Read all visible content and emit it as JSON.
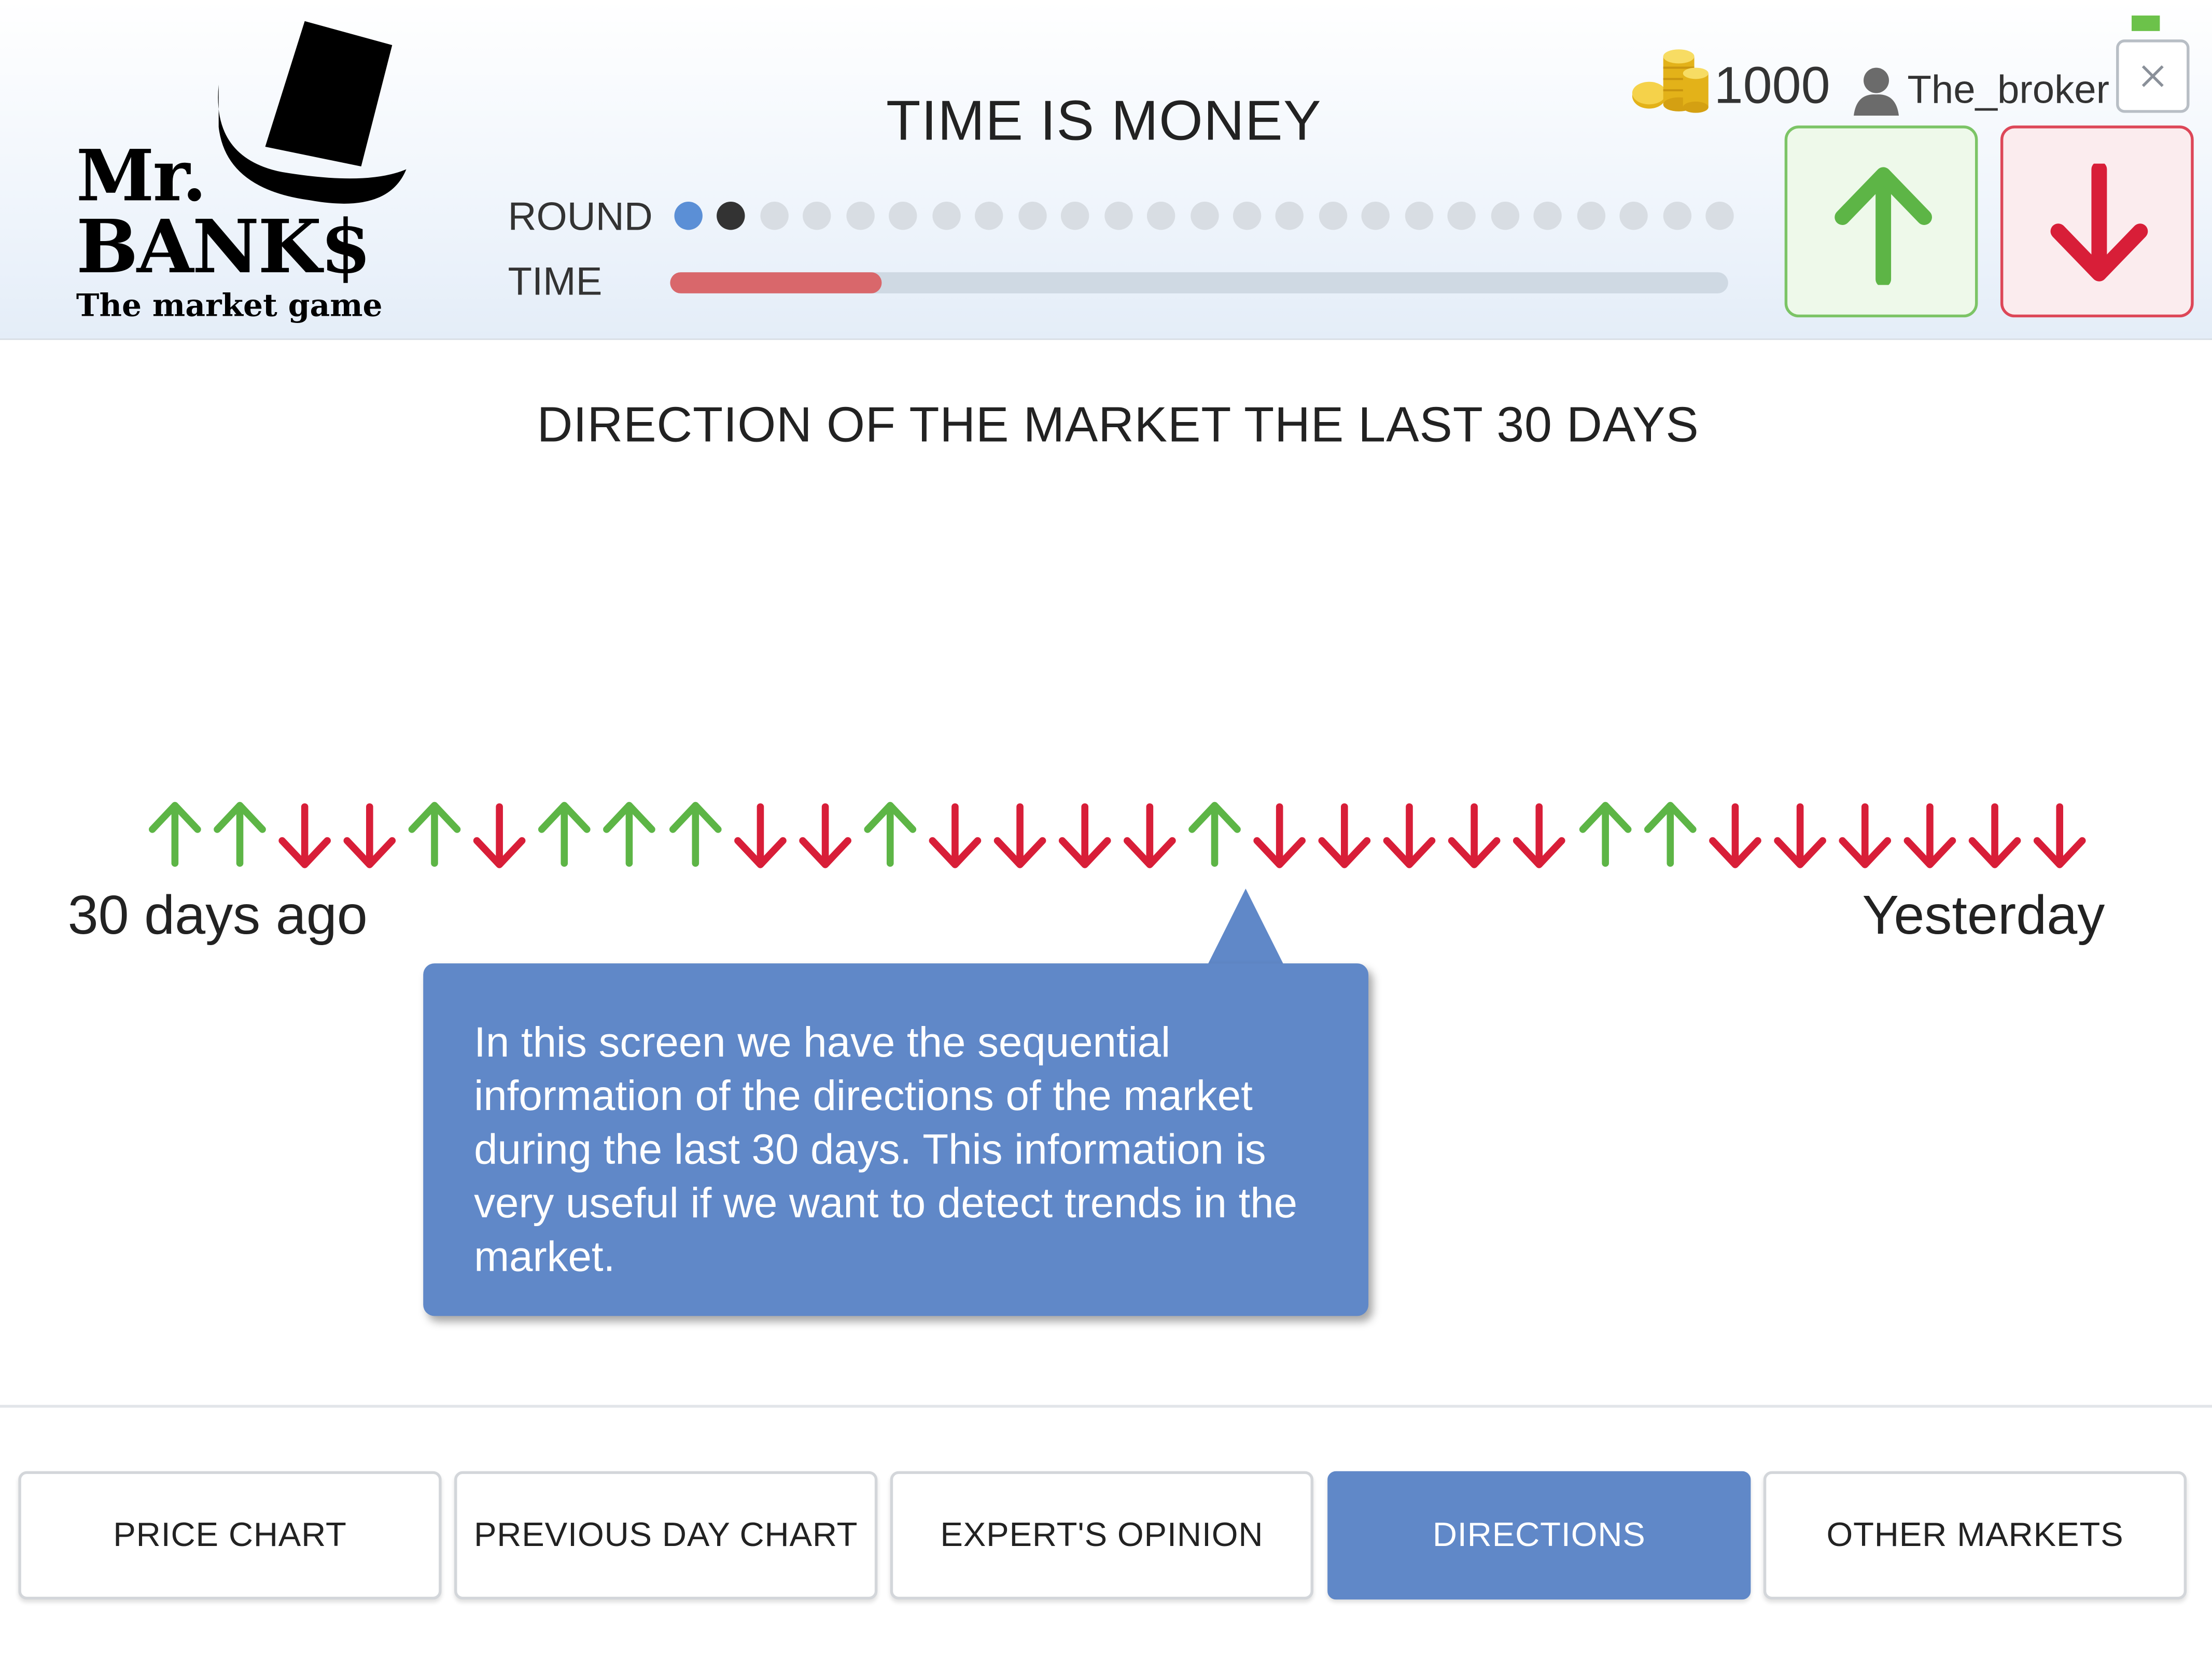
{
  "logo": {
    "line1": "Mr.",
    "line2": "BANK$",
    "tagline": "The market game"
  },
  "game": {
    "title": "TIME IS MONEY",
    "round_label": "ROUND",
    "time_label": "TIME",
    "rounds_total": 25,
    "rounds_completed": 1,
    "current_round": 2,
    "time_elapsed_fraction": 0.2
  },
  "player": {
    "coins": "1000",
    "username": "The_broker"
  },
  "icons": {
    "coins": "coins-icon",
    "user": "user-icon",
    "close": "close-icon",
    "buy": "arrow-up-icon",
    "sell": "arrow-down-icon",
    "battery": "battery-icon"
  },
  "colors": {
    "up": "#5db546",
    "down": "#d81e38",
    "accent": "#6088c8",
    "time_fill": "#d9676b",
    "round_done": "#5b8fd6",
    "round_current": "#333333"
  },
  "main": {
    "section_title": "DIRECTION OF THE MARKET THE LAST 30 DAYS",
    "directions": [
      "up",
      "up",
      "down",
      "down",
      "up",
      "down",
      "up",
      "up",
      "up",
      "down",
      "down",
      "up",
      "down",
      "down",
      "down",
      "down",
      "up",
      "down",
      "down",
      "down",
      "down",
      "down",
      "up",
      "up",
      "down",
      "down",
      "down",
      "down",
      "down",
      "down"
    ],
    "label_start": "30 days ago",
    "label_end": "Yesterday",
    "callout_text": "In this screen we have the sequential information of the directions of the market during the last 30 days. This information is very useful if we want to detect trends in the market."
  },
  "tabs": [
    {
      "label": "PRICE CHART",
      "active": false
    },
    {
      "label": "PREVIOUS DAY CHART",
      "active": false
    },
    {
      "label": "EXPERT'S OPINION",
      "active": false
    },
    {
      "label": "DIRECTIONS",
      "active": true
    },
    {
      "label": "OTHER MARKETS",
      "active": false
    }
  ]
}
